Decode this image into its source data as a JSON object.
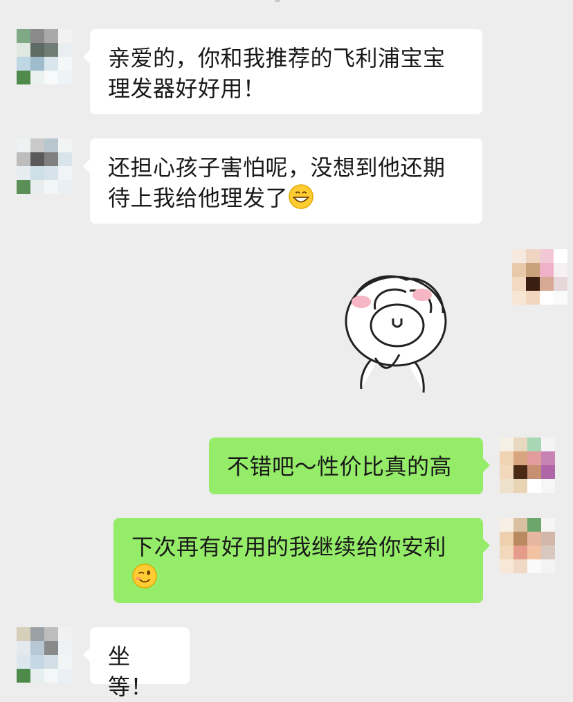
{
  "messages": [
    {
      "side": "in",
      "text": "亲爱的，你和我推荐的飞利浦宝宝理发器好好用！"
    },
    {
      "side": "in",
      "text": "还担心孩子害怕呢，没想到他还期待上我给他理发了",
      "emoji": "grinning-face-emoji"
    },
    {
      "side": "out",
      "sticker": "cartoon-head-sticker"
    },
    {
      "side": "out",
      "text": "不错吧～性价比真的高"
    },
    {
      "side": "out",
      "text": "下次再有好用的我继续给你安利",
      "emoji": "winking-face-emoji"
    },
    {
      "side": "in",
      "text": "坐等！"
    }
  ],
  "colors": {
    "background": "#ededed",
    "incoming_bubble": "#ffffff",
    "outgoing_bubble": "#95ec69"
  }
}
